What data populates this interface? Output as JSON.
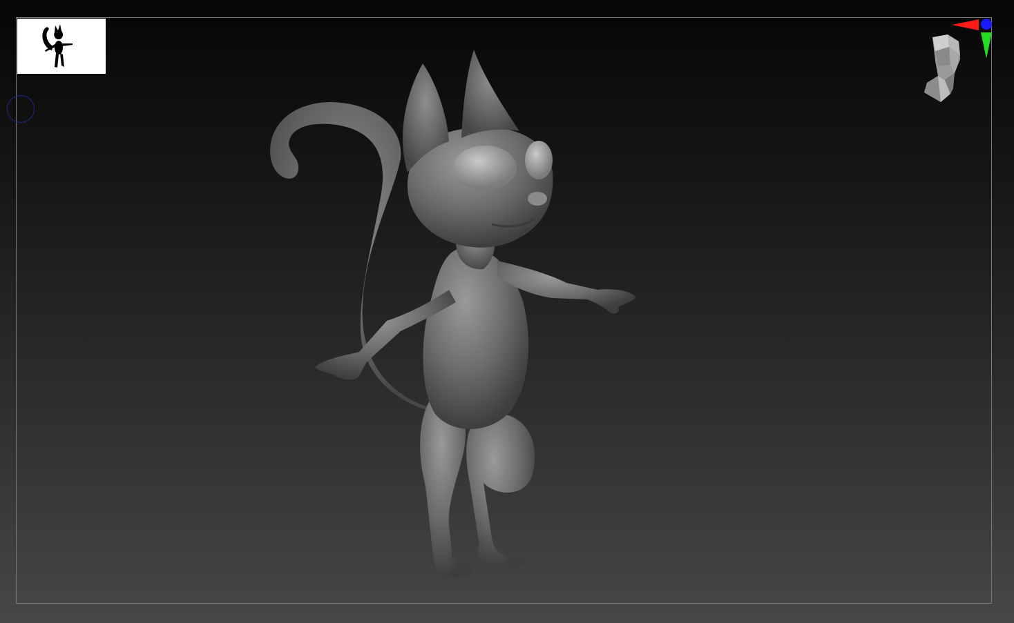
{
  "app": {
    "name": "",
    "viewport": {
      "background_top": "#060606",
      "background_bottom": "#474747",
      "frame_border_color": "#7a7a7a"
    }
  },
  "icons": {
    "thumbnail": "cat-silhouette-icon",
    "brush_cursor": "brush-circle-icon",
    "navigator_head": "head-navigator-icon",
    "axis_x": "axis-x-arrow-icon",
    "axis_y": "axis-y-arrow-icon",
    "axis_z": "axis-z-dot-icon"
  },
  "colors": {
    "axis_x": "#ff1a1a",
    "axis_y": "#22dd22",
    "axis_z": "#1a1aff",
    "model_base": "#6a6a6a",
    "brush_cursor": "#1e2a8c"
  }
}
